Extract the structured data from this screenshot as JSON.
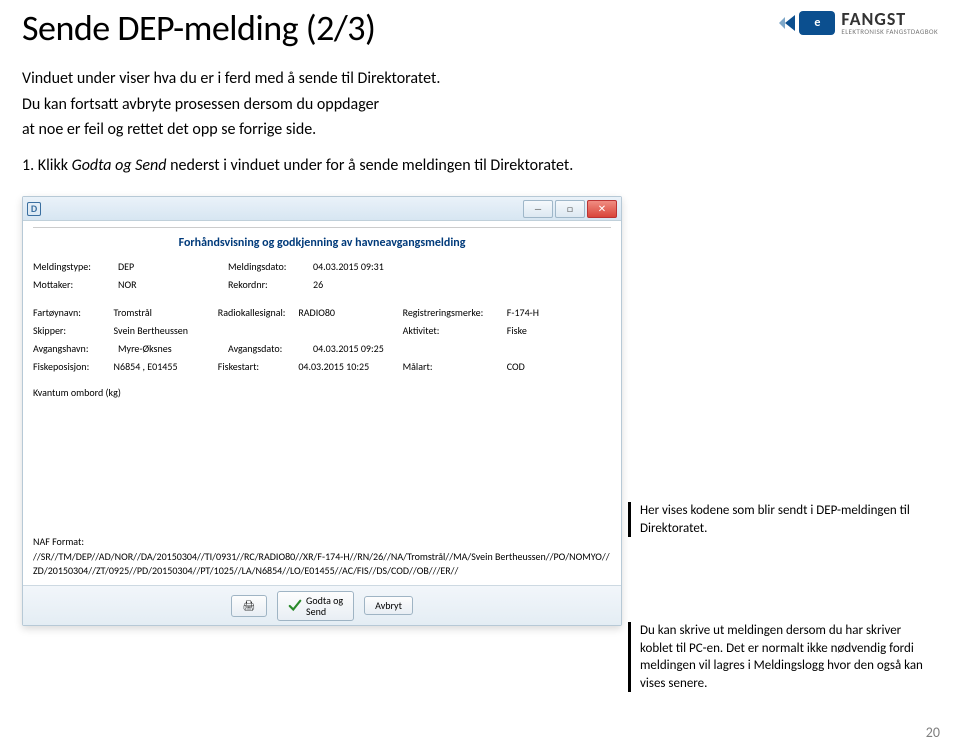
{
  "slide": {
    "title": "Sende DEP-melding (2/3)",
    "intro_p1": "Vinduet under viser hva du er i ferd med å sende til Direktoratet.",
    "intro_p2": "Du kan fortsatt avbryte prosessen dersom du oppdager",
    "intro_p3": "at noe er feil og rettet det opp  se forrige side.",
    "step_num": "1.",
    "step_text_pre": "Klikk ",
    "step_text_em": "Godta og Send",
    "step_text_post": "  nederst i vinduet under for å sende meldingen til Direktoratet."
  },
  "logo": {
    "badge": "e",
    "main": "FANGST",
    "sub": "ELEKTRONISK FANGSTDAGBOK"
  },
  "window": {
    "title_icon": "D",
    "inner_title": "Forhåndsvisning og godkjenning av havneavgangsmelding",
    "row1": {
      "meldingstype_lbl": "Meldingstype:",
      "meldingstype_val": "DEP",
      "meldingsdato_lbl": "Meldingsdato:",
      "meldingsdato_val": "04.03.2015 09:31"
    },
    "row1b": {
      "mottaker_lbl": "Mottaker:",
      "mottaker_val": "NOR",
      "rekordnr_lbl": "Rekordnr:",
      "rekordnr_val": "26"
    },
    "row2": {
      "fartoy_lbl": "Fartøynavn:",
      "fartoy_val": "Tromstrål",
      "radio_lbl": "Radiokallesignal:",
      "radio_val": "RADIO80",
      "regmerke_lbl": "Registreringsmerke:",
      "regmerke_val": "F-174-H"
    },
    "row3": {
      "skipper_lbl": "Skipper:",
      "skipper_val": "Svein Bertheussen",
      "aktivitet_lbl": "Aktivitet:",
      "aktivitet_val": "Fiske"
    },
    "row4": {
      "avghavn_lbl": "Avgangshavn:",
      "avghavn_val": "Myre-Øksnes",
      "avgdato_lbl": "Avgangsdato:",
      "avgdato_val": "04.03.2015 09:25"
    },
    "row5": {
      "fiskepos_lbl": "Fiskeposisjon:",
      "fiskepos_val": "N6854 , E01455",
      "fiskestart_lbl": "Fiskestart:",
      "fiskestart_val": "04.03.2015 10:25",
      "malart_lbl": "Målart:",
      "malart_val": "COD"
    },
    "row6": {
      "kvantum_lbl": "Kvantum ombord (kg)"
    },
    "naf_lbl": "NAF Format:",
    "naf_code": "//SR//TM/DEP//AD/NOR//DA/20150304//TI/0931//RC/RADIO80//XR/F-174-H//RN/26//NA/Tromstrål//MA/Svein Bertheussen//PO/NOMYO//ZD/20150304//ZT/0925//PD/20150304//PT/1025//LA/N6854//LO/E01455//AC/FIS//DS/COD//OB///ER//",
    "print_icon": "🖨",
    "btn_godta_l1": "Godta og",
    "btn_godta_l2": "Send",
    "btn_avbryt": "Avbryt"
  },
  "callouts": {
    "c1": "Her vises kodene som blir sendt i DEP-meldingen til Direktoratet.",
    "c2": "Du kan skrive ut meldingen dersom du har skriver koblet til PC-en. Det er normalt ikke nødvendig fordi meldingen vil lagres i Meldingslogg hvor den også kan vises senere."
  },
  "page_number": "20"
}
